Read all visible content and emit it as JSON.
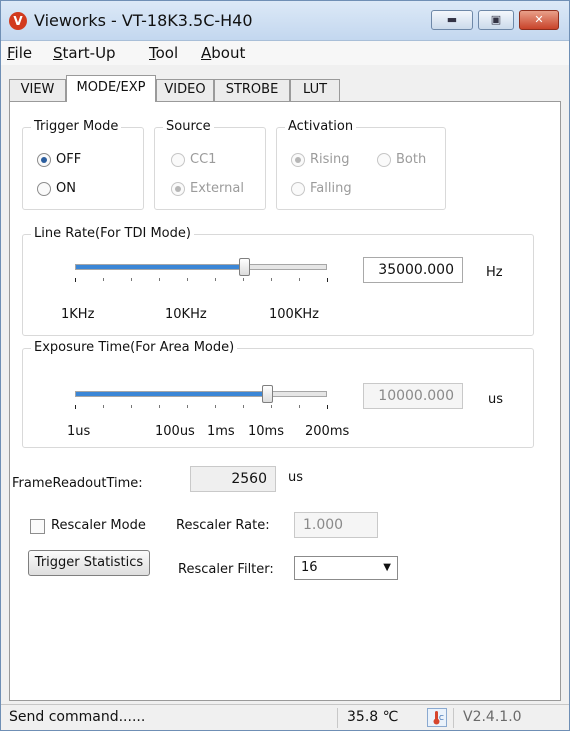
{
  "window": {
    "title": "Vieworks - VT-18K3.5C-H40",
    "app_icon": "vieworks-logo-icon",
    "buttons": [
      "minimize",
      "maximize",
      "close"
    ],
    "close_color": "#c8432a"
  },
  "menu": [
    "File",
    "Start-Up",
    "Tool",
    "About"
  ],
  "tabs": [
    {
      "label": "VIEW",
      "active": false
    },
    {
      "label": "MODE/EXP",
      "active": true
    },
    {
      "label": "VIDEO",
      "active": false
    },
    {
      "label": "STROBE",
      "active": false
    },
    {
      "label": "LUT",
      "active": false
    }
  ],
  "trigger_mode": {
    "legend": "Trigger Mode",
    "options": [
      "OFF",
      "ON"
    ],
    "selected": "OFF"
  },
  "source": {
    "legend": "Source",
    "options": [
      "CC1",
      "External"
    ],
    "selected": "External",
    "enabled": false
  },
  "activation": {
    "legend": "Activation",
    "options": [
      "Rising",
      "Both",
      "Falling"
    ],
    "selected": "Rising",
    "enabled": false
  },
  "line_rate": {
    "legend": "Line Rate(For TDI Mode)",
    "value": "35000.000",
    "unit": "Hz",
    "tick_labels": [
      "1KHz",
      "10KHz",
      "100KHz"
    ],
    "slider_position": 0.67
  },
  "exposure": {
    "legend": "Exposure Time(For Area Mode)",
    "value": "10000.000",
    "unit": "us",
    "enabled": false,
    "tick_labels": [
      "1us",
      "100us",
      "1ms",
      "10ms",
      "200ms"
    ],
    "slider_position": 0.76
  },
  "frame_readout": {
    "label": "FrameReadoutTime:",
    "value": "2560",
    "unit": "us"
  },
  "rescaler": {
    "mode_label": "Rescaler Mode",
    "mode_checked": false,
    "rate_label": "Rescaler Rate:",
    "rate_value": "1.000",
    "filter_label": "Rescaler Filter:",
    "filter_value": "16"
  },
  "trigger_stats_button": "Trigger Statistics",
  "status": {
    "message": "Send command......",
    "temperature": "35.8 ℃",
    "temp_icon": "temperature-icon",
    "version": "V2.4.1.0"
  }
}
